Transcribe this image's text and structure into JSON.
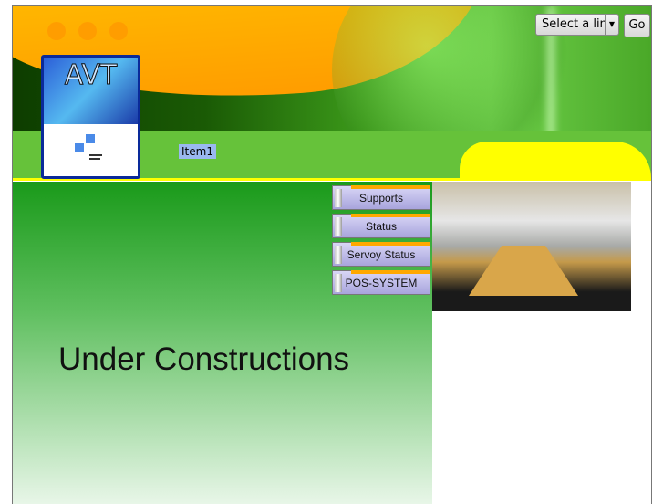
{
  "header": {
    "logo_text": "AVT",
    "menu_item": "Item1",
    "link_select": {
      "selected": "Select a lin"
    },
    "go_label": "Go"
  },
  "nav": {
    "items": [
      {
        "label": "Supports"
      },
      {
        "label": "Status"
      },
      {
        "label": "Servoy Status"
      },
      {
        "label": "POS-SYSTEM"
      }
    ]
  },
  "main": {
    "message": "Under Constructions"
  },
  "colors": {
    "accent_orange": "#ffa800",
    "header_green": "#66c23a",
    "yellow": "#ffff00"
  }
}
